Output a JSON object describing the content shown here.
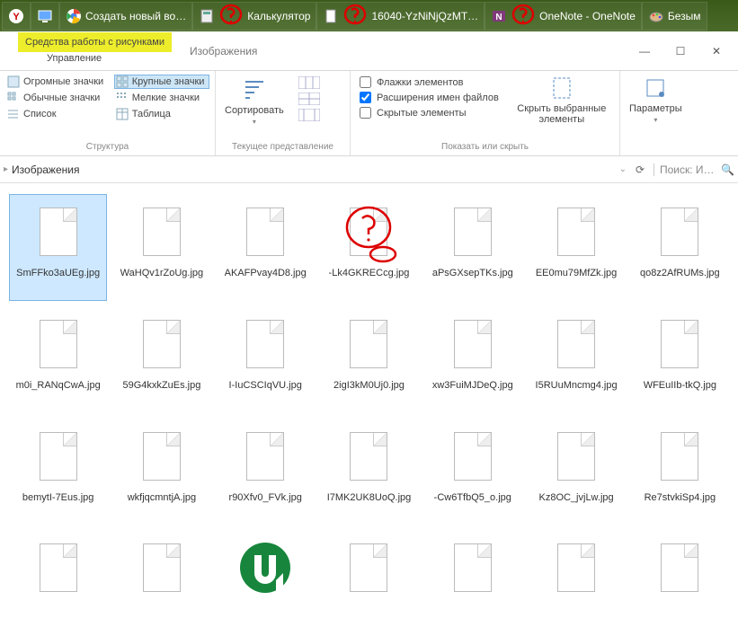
{
  "taskbar": {
    "items": [
      {
        "label": "",
        "icon": "yandex"
      },
      {
        "label": "",
        "icon": "desktop"
      },
      {
        "label": "Создать новый во…",
        "icon": "chrome"
      },
      {
        "label": "Калькулятор",
        "icon": "calc",
        "scribble": true
      },
      {
        "label": "16040-YzNiNjQzMT…",
        "icon": "file",
        "scribble": true
      },
      {
        "label": "OneNote - OneNote",
        "icon": "onenote",
        "scribble": true
      },
      {
        "label": "Безым",
        "icon": "paint"
      }
    ]
  },
  "tool_tabs": {
    "context_tab": "Средства работы с рисунками",
    "subtitle": "Управление",
    "active_tab": "Изображения"
  },
  "window_controls": {
    "min": "—",
    "max": "☐",
    "close": "✕"
  },
  "ribbon": {
    "structure": {
      "label": "Структура",
      "items": [
        "Огромные значки",
        "Крупные значки",
        "Обычные значки",
        "Мелкие значки",
        "Список",
        "Таблица"
      ]
    },
    "current_view": {
      "label": "Текущее представление",
      "sort": "Сортировать"
    },
    "show_hide": {
      "label": "Показать или скрыть",
      "flags": "Флажки элементов",
      "ext": "Расширения имен файлов",
      "hidden": "Скрытые элементы",
      "hide_selected": "Скрыть выбранные элементы"
    },
    "params": "Параметры"
  },
  "breadcrumb": {
    "location": "Изображения",
    "search_placeholder": "Поиск: И…"
  },
  "files": [
    {
      "name": "SmFFko3aUEg.jpg",
      "selected": true
    },
    {
      "name": "WaHQv1rZoUg.jpg"
    },
    {
      "name": "AKAFPvay4D8.jpg"
    },
    {
      "name": "-Lk4GKRECcg.jpg",
      "scribble": true
    },
    {
      "name": "aPsGXsepTKs.jpg"
    },
    {
      "name": "EE0mu79MfZk.jpg"
    },
    {
      "name": "qo8z2AfRUMs.jpg"
    },
    {
      "name": "m0i_RANqCwA.jpg"
    },
    {
      "name": "59G4kxkZuEs.jpg"
    },
    {
      "name": "I-IuCSCIqVU.jpg"
    },
    {
      "name": "2igI3kM0Uj0.jpg"
    },
    {
      "name": "xw3FuiMJDeQ.jpg"
    },
    {
      "name": "I5RUuMncmg4.jpg"
    },
    {
      "name": "WFEuIIb-tkQ.jpg"
    },
    {
      "name": "bemytI-7Eus.jpg"
    },
    {
      "name": "wkfjqcmntjA.jpg"
    },
    {
      "name": "r90Xfv0_FVk.jpg"
    },
    {
      "name": "I7MK2UK8UoQ.jpg"
    },
    {
      "name": "-Cw6TfbQ5_o.jpg"
    },
    {
      "name": "Kz8OC_jvjLw.jpg"
    },
    {
      "name": "Re7stvkiSp4.jpg"
    },
    {
      "name": "",
      "blank": true
    },
    {
      "name": "",
      "blank": true
    },
    {
      "name": "",
      "utorrent": true
    },
    {
      "name": "",
      "blank": true
    },
    {
      "name": "",
      "blank": true
    },
    {
      "name": "",
      "blank": true
    },
    {
      "name": "",
      "blank": true
    }
  ]
}
